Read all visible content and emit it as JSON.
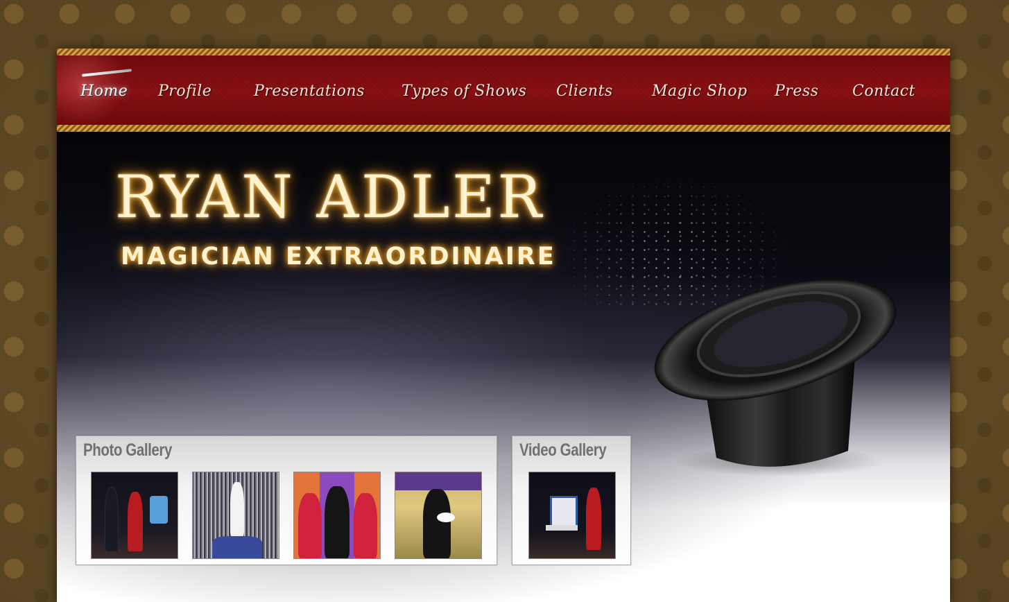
{
  "nav": {
    "items": [
      {
        "label": "Home",
        "active": true
      },
      {
        "label": "Profile"
      },
      {
        "label": "Presentations"
      },
      {
        "label": "Types of Shows"
      },
      {
        "label": "Clients"
      },
      {
        "label": "Magic Shop"
      },
      {
        "label": "Press"
      },
      {
        "label": "Contact"
      }
    ]
  },
  "banner": {
    "title": "RYAN ADLER",
    "subtitle": "MAGICIAN EXTRAORDINAIRE"
  },
  "photo_gallery": {
    "title": "Photo Gallery",
    "thumbnails": [
      "stage-duo",
      "silver-curtain",
      "group-pose",
      "dove-trick"
    ]
  },
  "video_gallery": {
    "title": "Video Gallery",
    "thumbnails": [
      "illusion-box-stage"
    ]
  },
  "colors": {
    "nav_red": "#8a1014",
    "gold_trim": "#d9a04a",
    "title_glow": "#ffb43a",
    "page_brown": "#5e4a22"
  }
}
